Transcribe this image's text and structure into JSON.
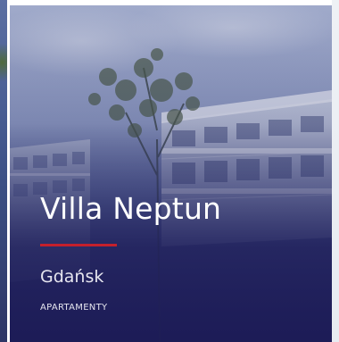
{
  "card": {
    "title": "Villa Neptun",
    "city": "Gdańsk",
    "category": "APARTAMENTY"
  },
  "colors": {
    "overlay": "#1c1b56",
    "accent": "#c4202c",
    "text": "#ffffff"
  },
  "icons": {
    "background": "building-photo"
  }
}
